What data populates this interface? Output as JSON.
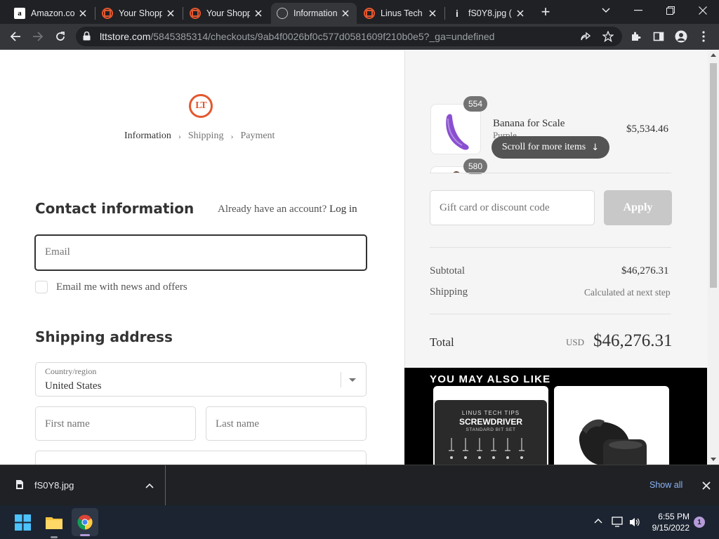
{
  "browser": {
    "tabs": [
      {
        "title": "Amazon.com",
        "icon": "amazon-icon"
      },
      {
        "title": "Your Shopping",
        "icon": "ltt-icon"
      },
      {
        "title": "Your Shopping",
        "icon": "ltt-icon"
      },
      {
        "title": "Information",
        "icon": "globe-icon",
        "active": true
      },
      {
        "title": "Linus Tech",
        "icon": "ltt-icon"
      },
      {
        "title": "fS0Y8.jpg (",
        "icon": "file-icon"
      }
    ],
    "url_host": "lttstore.com",
    "url_path": "/5845385314/checkouts/9ab4f0026bf0c577d0581609f210b0e5?_ga=undefined"
  },
  "checkout": {
    "logo_text": "LT",
    "breadcrumbs": {
      "information": "Information",
      "shipping": "Shipping",
      "payment": "Payment"
    },
    "contact": {
      "heading": "Contact information",
      "account_prompt": "Already have an account?",
      "login_label": "Log in",
      "email_placeholder": "Email",
      "newsletter_label": "Email me with news and offers"
    },
    "shipping": {
      "heading": "Shipping address",
      "country_label": "Country/region",
      "country_value": "United States",
      "first_name_placeholder": "First name",
      "last_name_placeholder": "Last name"
    }
  },
  "summary": {
    "items": [
      {
        "qty": "554",
        "name": "Banana for Scale",
        "variant": "Purple",
        "price": "$5,534.46"
      },
      {
        "qty": "580"
      }
    ],
    "scroll_hint": "Scroll for more items",
    "discount_placeholder": "Gift card or discount code",
    "apply_label": "Apply",
    "subtotal_label": "Subtotal",
    "subtotal_value": "$46,276.31",
    "shipping_label": "Shipping",
    "shipping_value": "Calculated at next step",
    "total_label": "Total",
    "currency": "USD",
    "total_value": "$46,276.31",
    "upsell_title": "YOU MAY ALSO LIKE",
    "upsell_card1": {
      "line1": "LINUS TECH TIPS",
      "line2": "SCREWDRIVER",
      "line3": "STANDARD BIT SET"
    }
  },
  "downloads": {
    "file_name": "fS0Y8.jpg",
    "show_all": "Show all"
  },
  "taskbar": {
    "time": "6:55 PM",
    "date": "9/15/2022",
    "notifications": "1"
  },
  "colors": {
    "brand_orange": "#e4572e",
    "banana_purple": "#8a4fd0"
  }
}
